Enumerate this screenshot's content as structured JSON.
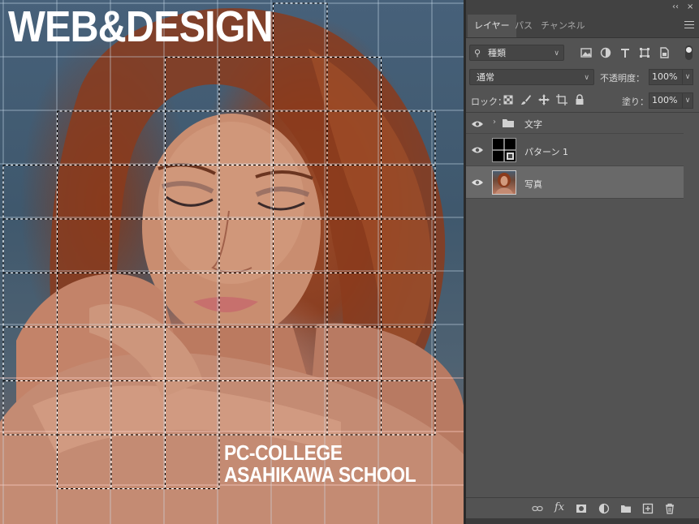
{
  "canvas": {
    "logo_text": "WEB&DESIGN",
    "caption_line1": "PC-COLLEGE",
    "caption_line2": "ASAHIKAWA SCHOOL"
  },
  "panel": {
    "collapse_glyph": "‹‹",
    "close_glyph": "×",
    "tabs": [
      {
        "label": "レイヤー",
        "active": true
      },
      {
        "label": "パス",
        "active": false
      },
      {
        "label": "チャンネル",
        "active": false
      }
    ],
    "filter": {
      "kind_label": "種類",
      "icons": [
        "image-filter-icon",
        "adjustment-filter-icon",
        "type-filter-icon",
        "shape-filter-icon",
        "smart-object-filter-icon"
      ]
    },
    "blend_mode": "通常",
    "opacity_label": "不透明度：",
    "opacity_value": "100%",
    "lock_label": "ロック：",
    "fill_label": "塗り：",
    "fill_value": "100%",
    "layers": [
      {
        "name": "文字",
        "type": "group",
        "visible": true,
        "selected": false
      },
      {
        "name": "パターン 1",
        "type": "fill",
        "visible": true,
        "selected": false
      },
      {
        "name": "写真",
        "type": "image",
        "visible": true,
        "selected": true
      }
    ],
    "bottom_icons": [
      "link-layers-icon",
      "fx-icon",
      "add-mask-icon",
      "adjustment-layer-icon",
      "new-group-icon",
      "new-layer-icon",
      "delete-layer-icon"
    ],
    "fx_label": "fx"
  },
  "colors": {
    "panel_bg": "#535353",
    "panel_dark": "#424242",
    "selected_row": "#696969"
  }
}
